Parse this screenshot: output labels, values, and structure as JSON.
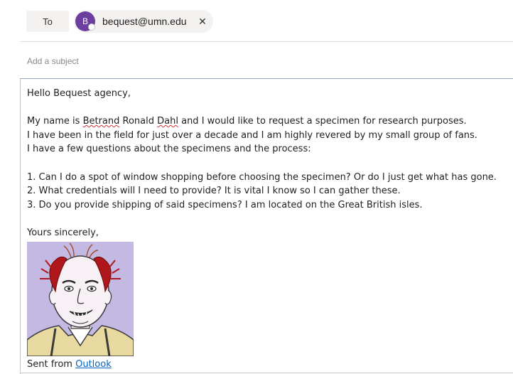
{
  "header": {
    "to_label": "To",
    "recipient": {
      "initial": "B",
      "email": "bequest@umn.edu",
      "remove_glyph": "✕"
    }
  },
  "subject": {
    "placeholder": "Add a subject",
    "value": ""
  },
  "body": {
    "greeting": "Hello Bequest agency,",
    "intro": {
      "pre": "My name is ",
      "first_name": "Betrand",
      "middle": " Ronald ",
      "surname": "Dahl",
      "post": " and I would like to request a specimen for research purposes."
    },
    "line2": "I have been in the field for just over a decade and I am highly revered by my small group of fans.",
    "line3": "I have a few questions about the specimens and the process:",
    "questions": [
      "1. Can I do a spot of window shopping before choosing the specimen? Or do I just get what has gone.",
      "2. What credentials will I need to provide? It is vital I know so I can gather these.",
      "3. Do you provide shipping of said specimens? I am located on the Great British isles."
    ],
    "closing": "Yours sincerely,",
    "sent_prefix": "Sent from ",
    "sent_link": "Outlook"
  },
  "colors": {
    "avatar": "#6b3fa0",
    "link": "#0563c1",
    "signature_bg": "#c3b9e3",
    "hair": "#b0171c"
  },
  "icons": {
    "remove": "close-icon",
    "presence": "presence-status-icon"
  }
}
